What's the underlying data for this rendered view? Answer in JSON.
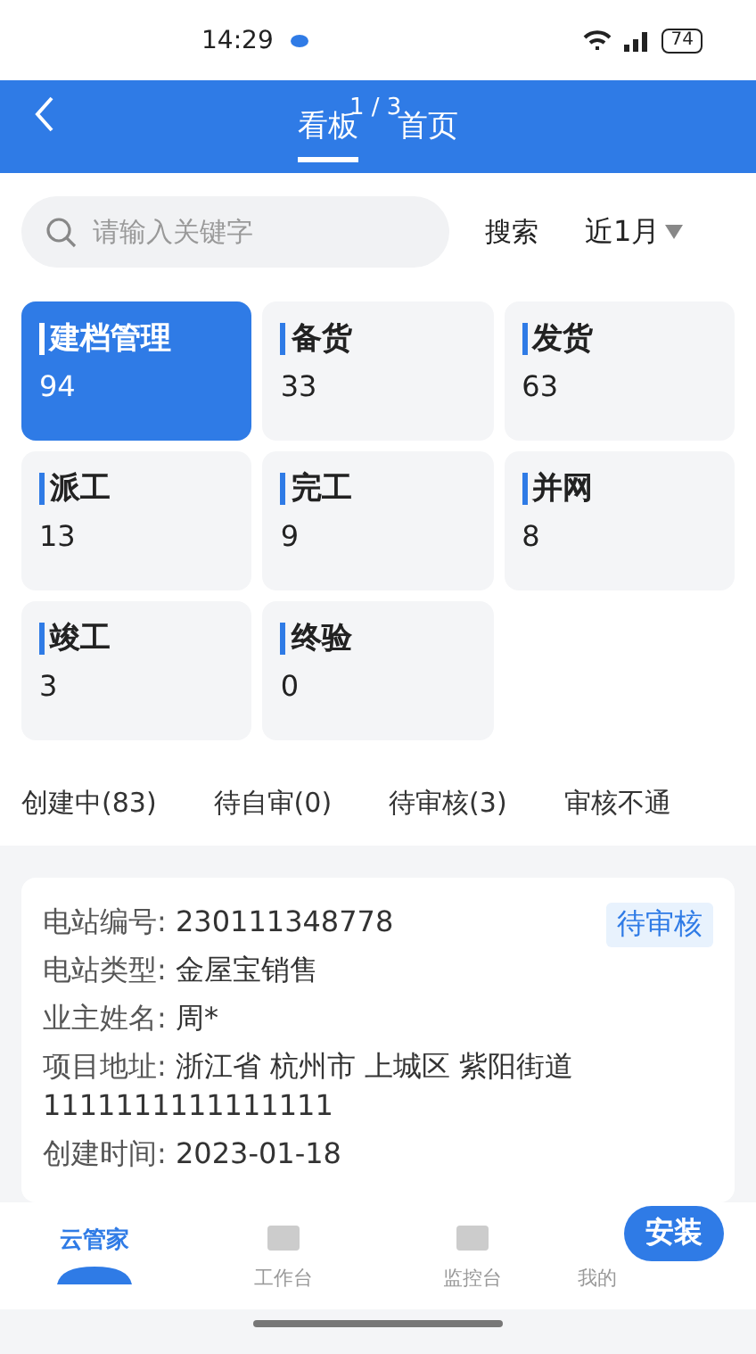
{
  "status_bar": {
    "time": "14:29",
    "battery": "74"
  },
  "header": {
    "tabs": [
      {
        "label": "看板",
        "selected": true
      },
      {
        "label": "首页",
        "selected": false
      }
    ],
    "page_indicator": "1 / 3"
  },
  "search": {
    "placeholder": "请输入关键字",
    "button": "搜索",
    "period": "近1月"
  },
  "stats": [
    {
      "label": "建档管理",
      "count": "94",
      "selected": true
    },
    {
      "label": "备货",
      "count": "33",
      "selected": false
    },
    {
      "label": "发货",
      "count": "63",
      "selected": false
    },
    {
      "label": "派工",
      "count": "13",
      "selected": false
    },
    {
      "label": "完工",
      "count": "9",
      "selected": false
    },
    {
      "label": "并网",
      "count": "8",
      "selected": false
    },
    {
      "label": "竣工",
      "count": "3",
      "selected": false
    },
    {
      "label": "终验",
      "count": "0",
      "selected": false
    }
  ],
  "status_tabs": [
    "创建中(83)",
    "待自审(0)",
    "待审核(3)",
    "审核不通"
  ],
  "record": {
    "badge": "待审核",
    "fields": [
      {
        "label": "电站编号:",
        "value": "230111348778"
      },
      {
        "label": "电站类型:",
        "value": "金屋宝销售"
      },
      {
        "label": "业主姓名:",
        "value": "周*"
      },
      {
        "label": "项目地址:",
        "value": "浙江省 杭州市 上城区 紫阳街道 1111111111111111"
      },
      {
        "label": "创建时间:",
        "value": "2023-01-18"
      }
    ]
  },
  "nav": [
    {
      "kind": "logo",
      "label": "云管家",
      "selected": true
    },
    {
      "kind": "tab",
      "label": "工作台",
      "selected": false
    },
    {
      "kind": "tab",
      "label": "监控台",
      "selected": false
    },
    {
      "kind": "covered",
      "label": "我的",
      "selected": false
    }
  ],
  "install_button": "安装"
}
